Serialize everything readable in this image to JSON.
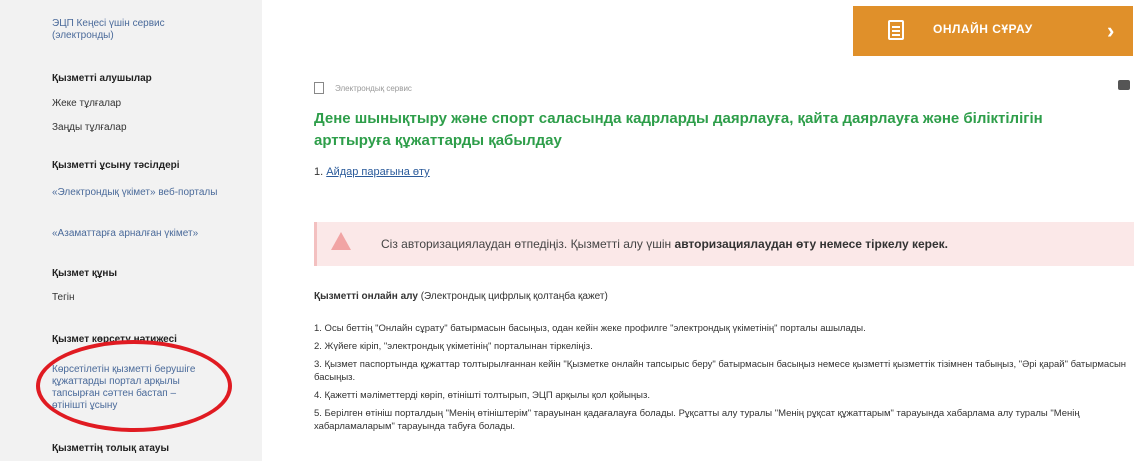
{
  "sidebar": {
    "top_link": [
      "ЭЦП Кеңесі үшін сервис",
      "(электронды)"
    ],
    "providers_heading": "Қызметті алушылар",
    "providers": [
      "Жеке тұлғалар",
      "Заңды тұлғалар"
    ],
    "methods_heading": "Қызметті ұсыну тәсілдері",
    "methods": [
      "«Электрондық үкімет» веб-порталы",
      "«Азаматтарға арналған үкімет»"
    ],
    "cost_heading": "Қызмет құны",
    "cost_value": "Тегін",
    "result_heading": "Қызмет көрсету нәтижесі",
    "result_text": [
      "Көрсетілетін қызметті берушіге",
      "құжаттарды портал арқылы",
      "тапсырған сәттен бастап –",
      "өтінішті ұсыну"
    ],
    "full_name_heading": "Қызметтің толық атауы"
  },
  "online_button": {
    "label": "ОНЛАЙН СҰРАУ",
    "chevron": "›"
  },
  "breadcrumb": "Электрондық сервис",
  "title": "Дене шынықтыру және спорт саласында кадрларды даярлауға, қайта даярлауға және біліктілігін арттыруға құжаттарды қабылдау",
  "link": {
    "prefix": "1. ",
    "text": "Айдар парағына өту"
  },
  "alert": {
    "text_normal": "Сіз авторизациялаудан өтпедіңіз. Қызметті алу үшін ",
    "text_bold": "авторизациялаудан өту немесе тіркелу керек."
  },
  "online_section": {
    "bold": "Қызметті онлайн алу",
    "rest": " (Электрондық цифрлық қолтаңба қажет)"
  },
  "steps": [
    "1. Осы беттің \"Онлайн сұрату\" батырмасын басыңыз, одан кейін жеке профилге \"электрондық үкіметінің\" порталы ашылады.",
    "2. Жүйеге кіріп, \"электрондық үкіметінің\" порталынан тіркеліңіз.",
    "3. Қызмет паспортында құжаттар толтырылғаннан кейін \"Қызметке онлайн тапсырыс беру\" батырмасын басыңыз немесе қызметті қызметтік тізімнен табыңыз, \"Әрі қарай\" батырмасын басыңыз.",
    "4. Қажетті мәліметтерді көріп, өтінішті толтырып, ЭЦП арқылы қол қойыңыз.",
    "5. Берілген өтініш порталдың \"Менің өтініштерім\" тарауынан қадағалауға болады. Рұқсатты алу туралы \"Менің рұқсат құжаттарым\" тарауында хабарлама алу туралы \"Менің хабарламаларым\" тарауында табуға болады."
  ]
}
